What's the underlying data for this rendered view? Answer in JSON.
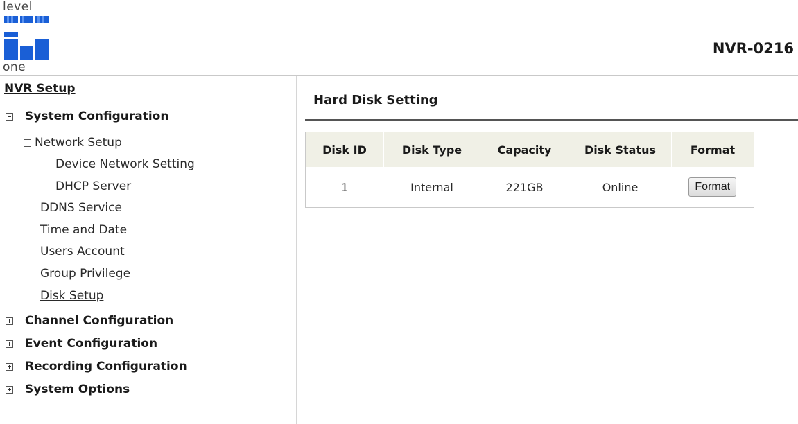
{
  "header": {
    "logo_top": "level",
    "logo_bottom": "one",
    "model": "NVR-0216"
  },
  "sidebar": {
    "title": "NVR Setup",
    "system_configuration": "System Configuration",
    "network_setup": "Network Setup",
    "device_network_setting": "Device Network Setting",
    "dhcp_server": "DHCP Server",
    "ddns_service": "DDNS Service",
    "time_and_date": "Time and Date",
    "users_account": "Users Account",
    "group_privilege": "Group Privilege",
    "disk_setup": "Disk Setup",
    "channel_configuration": "Channel Configuration",
    "event_configuration": "Event Configuration",
    "recording_configuration": "Recording Configuration",
    "system_options": "System Options"
  },
  "main": {
    "title": "Hard Disk Setting",
    "columns": [
      "Disk ID",
      "Disk Type",
      "Capacity",
      "Disk Status",
      "Format"
    ],
    "rows": [
      {
        "disk_id": "1",
        "disk_type": "Internal",
        "capacity": "221GB",
        "disk_status": "Online",
        "format_button": "Format"
      }
    ]
  },
  "colors": {
    "header_bg": "#f0f0e6",
    "logo_blue": "#1a5fd6"
  }
}
